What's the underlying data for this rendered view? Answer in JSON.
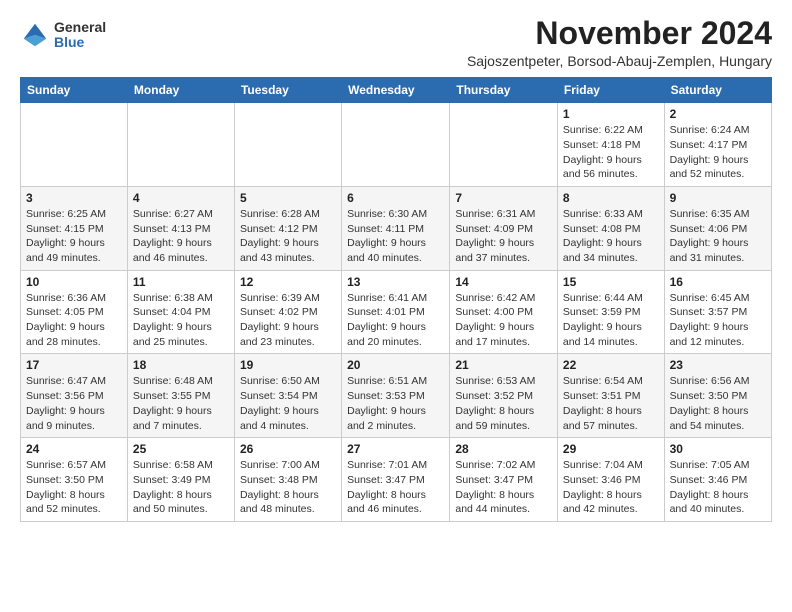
{
  "logo": {
    "general": "General",
    "blue": "Blue"
  },
  "title": "November 2024",
  "subtitle": "Sajoszentpeter, Borsod-Abauj-Zemplen, Hungary",
  "weekdays": [
    "Sunday",
    "Monday",
    "Tuesday",
    "Wednesday",
    "Thursday",
    "Friday",
    "Saturday"
  ],
  "weeks": [
    [
      {
        "day": "",
        "info": ""
      },
      {
        "day": "",
        "info": ""
      },
      {
        "day": "",
        "info": ""
      },
      {
        "day": "",
        "info": ""
      },
      {
        "day": "",
        "info": ""
      },
      {
        "day": "1",
        "info": "Sunrise: 6:22 AM\nSunset: 4:18 PM\nDaylight: 9 hours and 56 minutes."
      },
      {
        "day": "2",
        "info": "Sunrise: 6:24 AM\nSunset: 4:17 PM\nDaylight: 9 hours and 52 minutes."
      }
    ],
    [
      {
        "day": "3",
        "info": "Sunrise: 6:25 AM\nSunset: 4:15 PM\nDaylight: 9 hours and 49 minutes."
      },
      {
        "day": "4",
        "info": "Sunrise: 6:27 AM\nSunset: 4:13 PM\nDaylight: 9 hours and 46 minutes."
      },
      {
        "day": "5",
        "info": "Sunrise: 6:28 AM\nSunset: 4:12 PM\nDaylight: 9 hours and 43 minutes."
      },
      {
        "day": "6",
        "info": "Sunrise: 6:30 AM\nSunset: 4:11 PM\nDaylight: 9 hours and 40 minutes."
      },
      {
        "day": "7",
        "info": "Sunrise: 6:31 AM\nSunset: 4:09 PM\nDaylight: 9 hours and 37 minutes."
      },
      {
        "day": "8",
        "info": "Sunrise: 6:33 AM\nSunset: 4:08 PM\nDaylight: 9 hours and 34 minutes."
      },
      {
        "day": "9",
        "info": "Sunrise: 6:35 AM\nSunset: 4:06 PM\nDaylight: 9 hours and 31 minutes."
      }
    ],
    [
      {
        "day": "10",
        "info": "Sunrise: 6:36 AM\nSunset: 4:05 PM\nDaylight: 9 hours and 28 minutes."
      },
      {
        "day": "11",
        "info": "Sunrise: 6:38 AM\nSunset: 4:04 PM\nDaylight: 9 hours and 25 minutes."
      },
      {
        "day": "12",
        "info": "Sunrise: 6:39 AM\nSunset: 4:02 PM\nDaylight: 9 hours and 23 minutes."
      },
      {
        "day": "13",
        "info": "Sunrise: 6:41 AM\nSunset: 4:01 PM\nDaylight: 9 hours and 20 minutes."
      },
      {
        "day": "14",
        "info": "Sunrise: 6:42 AM\nSunset: 4:00 PM\nDaylight: 9 hours and 17 minutes."
      },
      {
        "day": "15",
        "info": "Sunrise: 6:44 AM\nSunset: 3:59 PM\nDaylight: 9 hours and 14 minutes."
      },
      {
        "day": "16",
        "info": "Sunrise: 6:45 AM\nSunset: 3:57 PM\nDaylight: 9 hours and 12 minutes."
      }
    ],
    [
      {
        "day": "17",
        "info": "Sunrise: 6:47 AM\nSunset: 3:56 PM\nDaylight: 9 hours and 9 minutes."
      },
      {
        "day": "18",
        "info": "Sunrise: 6:48 AM\nSunset: 3:55 PM\nDaylight: 9 hours and 7 minutes."
      },
      {
        "day": "19",
        "info": "Sunrise: 6:50 AM\nSunset: 3:54 PM\nDaylight: 9 hours and 4 minutes."
      },
      {
        "day": "20",
        "info": "Sunrise: 6:51 AM\nSunset: 3:53 PM\nDaylight: 9 hours and 2 minutes."
      },
      {
        "day": "21",
        "info": "Sunrise: 6:53 AM\nSunset: 3:52 PM\nDaylight: 8 hours and 59 minutes."
      },
      {
        "day": "22",
        "info": "Sunrise: 6:54 AM\nSunset: 3:51 PM\nDaylight: 8 hours and 57 minutes."
      },
      {
        "day": "23",
        "info": "Sunrise: 6:56 AM\nSunset: 3:50 PM\nDaylight: 8 hours and 54 minutes."
      }
    ],
    [
      {
        "day": "24",
        "info": "Sunrise: 6:57 AM\nSunset: 3:50 PM\nDaylight: 8 hours and 52 minutes."
      },
      {
        "day": "25",
        "info": "Sunrise: 6:58 AM\nSunset: 3:49 PM\nDaylight: 8 hours and 50 minutes."
      },
      {
        "day": "26",
        "info": "Sunrise: 7:00 AM\nSunset: 3:48 PM\nDaylight: 8 hours and 48 minutes."
      },
      {
        "day": "27",
        "info": "Sunrise: 7:01 AM\nSunset: 3:47 PM\nDaylight: 8 hours and 46 minutes."
      },
      {
        "day": "28",
        "info": "Sunrise: 7:02 AM\nSunset: 3:47 PM\nDaylight: 8 hours and 44 minutes."
      },
      {
        "day": "29",
        "info": "Sunrise: 7:04 AM\nSunset: 3:46 PM\nDaylight: 8 hours and 42 minutes."
      },
      {
        "day": "30",
        "info": "Sunrise: 7:05 AM\nSunset: 3:46 PM\nDaylight: 8 hours and 40 minutes."
      }
    ]
  ]
}
